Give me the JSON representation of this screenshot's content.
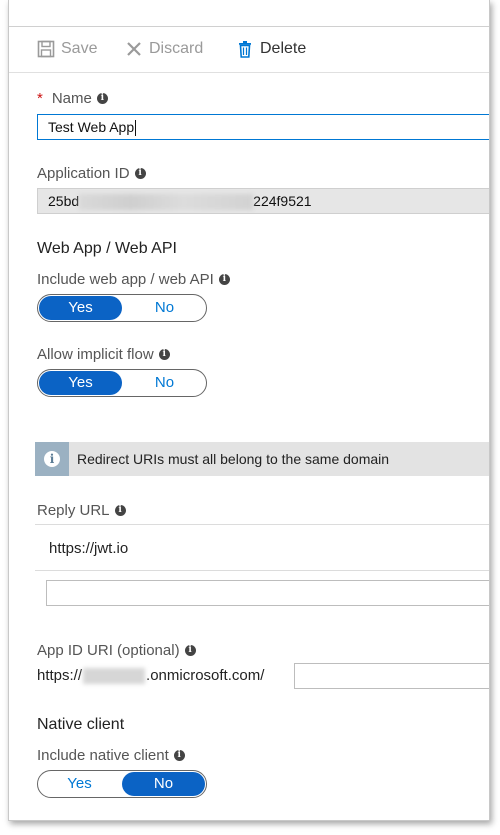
{
  "toolbar": {
    "save_label": "Save",
    "discard_label": "Discard",
    "delete_label": "Delete"
  },
  "name": {
    "label": "Name",
    "value": "Test Web App"
  },
  "application_id": {
    "label": "Application ID",
    "value_prefix": "25bd",
    "value_suffix": "224f9521"
  },
  "web_app": {
    "title": "Web App / Web API",
    "include_label": "Include web app / web API",
    "include_options": [
      "Yes",
      "No"
    ],
    "include_selected": "Yes",
    "implicit_label": "Allow implicit flow",
    "implicit_options": [
      "Yes",
      "No"
    ],
    "implicit_selected": "Yes"
  },
  "info_message": "Redirect URIs must all belong to the same domain",
  "reply_url": {
    "label": "Reply URL",
    "value": "https://jwt.io",
    "new_value": ""
  },
  "app_id_uri": {
    "label": "App ID URI (optional)",
    "prefix": "https://",
    "suffix": ".onmicrosoft.com/",
    "value": ""
  },
  "native_client": {
    "title": "Native client",
    "include_label": "Include native client",
    "options": [
      "Yes",
      "No"
    ],
    "selected": "No"
  },
  "colors": {
    "accent": "#0b63c5",
    "link_blue": "#0078d4",
    "required_star": "#cc1111"
  }
}
